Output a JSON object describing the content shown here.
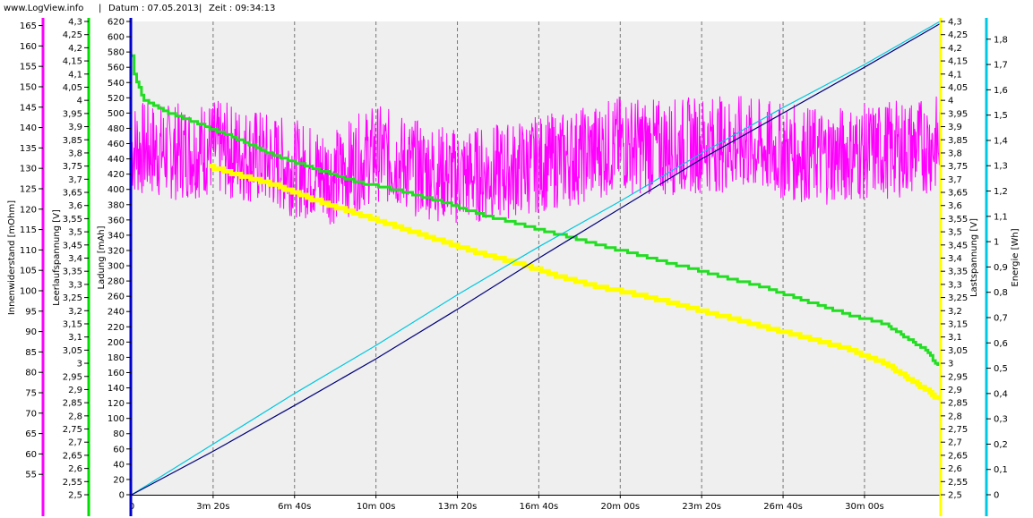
{
  "header": {
    "site": "www.LogView.info",
    "date_label": "Datum : 07.05.2013",
    "time_label": "Zeit : 09:34:13"
  },
  "chart_data": {
    "type": "line",
    "grid": true,
    "plot_background": "#efefef",
    "x_axis": {
      "min": 0,
      "max": 1985,
      "unit": "s",
      "ticks": [
        0,
        200,
        400,
        600,
        800,
        1000,
        1200,
        1400,
        1600,
        1800
      ],
      "tick_labels": [
        "0",
        "3m 20s",
        "6m 40s",
        "10m 00s",
        "13m 20s",
        "16m 40s",
        "20m 00s",
        "23m 20s",
        "26m 40s",
        "30m 00s"
      ]
    },
    "axes": [
      {
        "id": "innenwiderstand",
        "label": "Innenwiderstand [mOhm]",
        "color": "#ff00ff",
        "side": "left",
        "min": 50,
        "max": 166,
        "tick_labels": [
          "55",
          "60",
          "65",
          "70",
          "75",
          "80",
          "85",
          "90",
          "95",
          "100",
          "105",
          "110",
          "115",
          "120",
          "125",
          "130",
          "135",
          "140",
          "145",
          "150",
          "155",
          "160",
          "165"
        ]
      },
      {
        "id": "leerlaufspannung",
        "label": "Leerlaufspannung [V]",
        "color": "#00dd00",
        "side": "left",
        "min": 2.5,
        "max": 4.3,
        "tick_labels": [
          "2,5",
          "2,55",
          "2,6",
          "2,65",
          "2,7",
          "2,75",
          "2,8",
          "2,85",
          "2,9",
          "2,95",
          "3",
          "3,05",
          "3,1",
          "3,15",
          "3,2",
          "3,25",
          "3,3",
          "3,35",
          "3,4",
          "3,45",
          "3,5",
          "3,55",
          "3,6",
          "3,65",
          "3,7",
          "3,75",
          "3,8",
          "3,85",
          "3,9",
          "3,95",
          "4",
          "4,05",
          "4,1",
          "4,15",
          "4,2",
          "4,25",
          "4,3"
        ]
      },
      {
        "id": "ladung",
        "label": "Ladung [mAh]",
        "color": "#0000cc",
        "side": "left",
        "min": 0,
        "max": 620,
        "tick_labels": [
          "0",
          "20",
          "40",
          "60",
          "80",
          "100",
          "120",
          "140",
          "160",
          "180",
          "200",
          "220",
          "240",
          "260",
          "280",
          "300",
          "320",
          "340",
          "360",
          "380",
          "400",
          "420",
          "440",
          "460",
          "480",
          "500",
          "520",
          "540",
          "560",
          "580",
          "600",
          "620"
        ]
      },
      {
        "id": "lastspannung",
        "label": "Lastspannung [V]",
        "color": "#ffff00",
        "side": "right",
        "min": 2.5,
        "max": 4.3,
        "tick_labels": [
          "2,5",
          "2,55",
          "2,6",
          "2,65",
          "2,7",
          "2,75",
          "2,8",
          "2,85",
          "2,9",
          "2,95",
          "3",
          "3,05",
          "3,1",
          "3,15",
          "3,2",
          "3,25",
          "3,3",
          "3,35",
          "3,4",
          "3,45",
          "3,5",
          "3,55",
          "3,6",
          "3,65",
          "3,7",
          "3,75",
          "3,8",
          "3,85",
          "3,9",
          "3,95",
          "4",
          "4,05",
          "4,1",
          "4,15",
          "4,2",
          "4,25",
          "4,3"
        ]
      },
      {
        "id": "energie",
        "label": "Energie [Wh]",
        "color": "#00c8e0",
        "side": "right",
        "min": 0,
        "max": 1.87,
        "tick_labels": [
          "0",
          "0,1",
          "0,2",
          "0,3",
          "0,4",
          "0,5",
          "0,6",
          "0,7",
          "0,8",
          "0,9",
          "1",
          "1,1",
          "1,2",
          "1,3",
          "1,4",
          "1,5",
          "1,6",
          "1,7",
          "1,8"
        ]
      }
    ],
    "series": [
      {
        "axis": "ladung",
        "color": "#00007a",
        "style": "line",
        "x": [
          0,
          200,
          400,
          600,
          800,
          1000,
          1200,
          1400,
          1600,
          1800,
          1985
        ],
        "y": [
          0,
          57,
          117,
          178,
          243,
          310,
          375,
          440,
          500,
          560,
          617
        ]
      },
      {
        "axis": "energie",
        "color": "#00c8e0",
        "style": "line",
        "x": [
          0,
          200,
          400,
          600,
          800,
          1000,
          1200,
          1400,
          1600,
          1800,
          1985
        ],
        "y": [
          0,
          0.2,
          0.4,
          0.59,
          0.79,
          0.98,
          1.16,
          1.35,
          1.53,
          1.7,
          1.87
        ]
      },
      {
        "axis": "leerlaufspannung",
        "color": "#22dd22",
        "style": "step",
        "x": [
          0,
          5,
          30,
          80,
          150,
          250,
          350,
          450,
          550,
          650,
          750,
          850,
          950,
          1050,
          1150,
          1250,
          1350,
          1450,
          1550,
          1650,
          1750,
          1850,
          1950,
          1985
        ],
        "y": [
          4.17,
          4.1,
          4.0,
          3.96,
          3.92,
          3.86,
          3.79,
          3.74,
          3.69,
          3.66,
          3.62,
          3.57,
          3.53,
          3.49,
          3.45,
          3.41,
          3.37,
          3.33,
          3.29,
          3.24,
          3.19,
          3.15,
          3.05,
          2.98
        ]
      },
      {
        "axis": "lastspannung",
        "color": "#ffff00",
        "style": "step",
        "x": [
          190,
          250,
          350,
          450,
          550,
          650,
          750,
          850,
          950,
          1050,
          1150,
          1250,
          1350,
          1450,
          1550,
          1650,
          1750,
          1850,
          1950,
          1985
        ],
        "y": [
          3.75,
          3.72,
          3.68,
          3.62,
          3.57,
          3.52,
          3.47,
          3.42,
          3.38,
          3.33,
          3.29,
          3.26,
          3.22,
          3.18,
          3.14,
          3.1,
          3.06,
          3.0,
          2.9,
          2.86
        ]
      },
      {
        "axis": "innenwiderstand",
        "color": "#ff00ff",
        "style": "noise",
        "x": [
          0,
          100,
          200,
          300,
          400,
          500,
          600,
          700,
          800,
          900,
          1000,
          1100,
          1200,
          1300,
          1400,
          1500,
          1600,
          1700,
          1800,
          1900,
          1985
        ],
        "y": [
          135,
          134,
          135,
          133,
          130,
          128,
          134,
          130,
          128,
          129,
          131,
          133,
          136,
          135,
          136,
          136,
          134,
          133,
          134,
          135,
          136
        ],
        "spread": 12
      }
    ]
  }
}
